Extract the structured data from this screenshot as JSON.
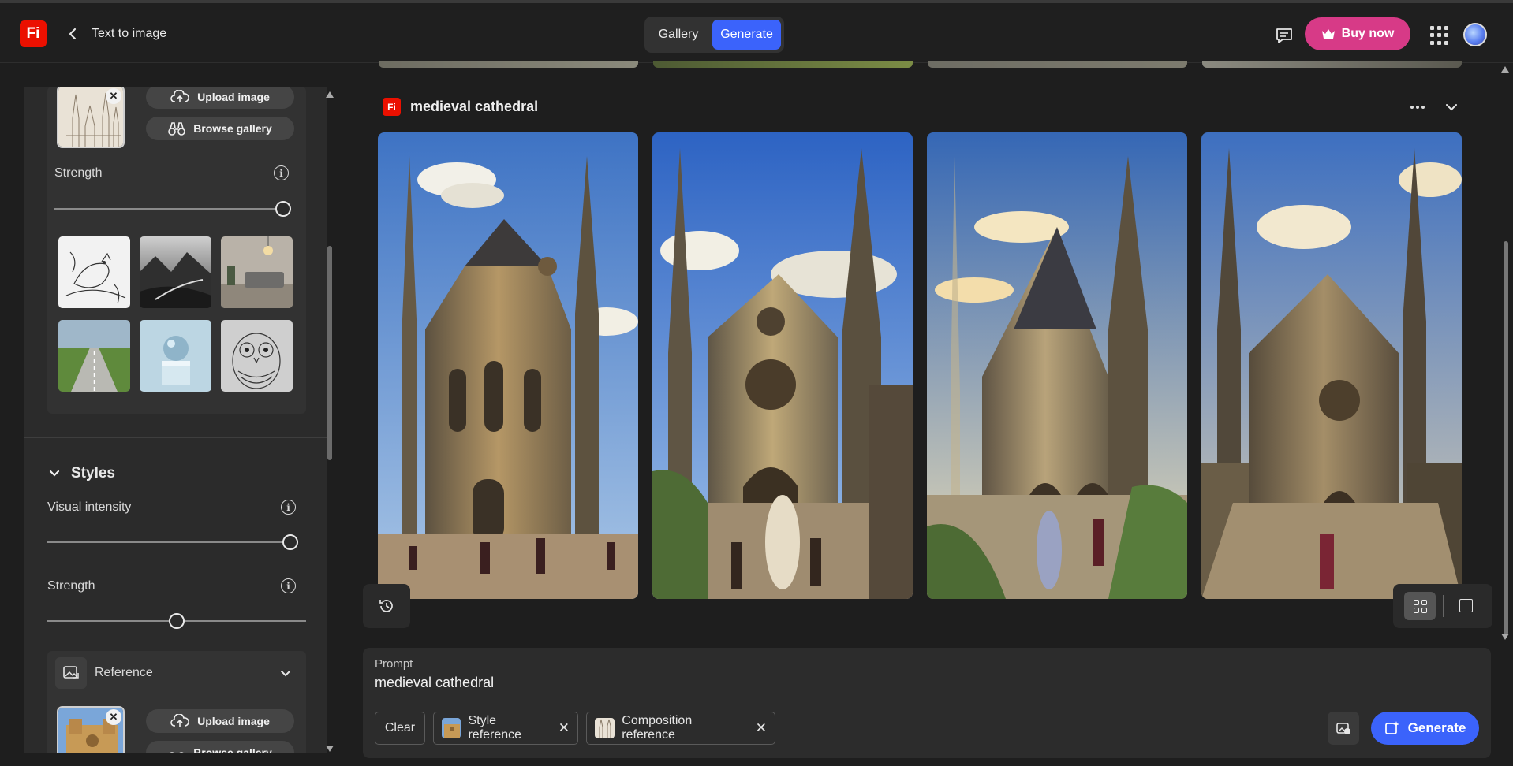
{
  "header": {
    "logo_text": "Fi",
    "title": "Text to image",
    "tabs": [
      {
        "label": "Gallery"
      },
      {
        "label": "Generate"
      }
    ],
    "active_tab": "Generate",
    "buy_label": "Buy now"
  },
  "left_panel": {
    "composition": {
      "upload_label": "Upload image",
      "browse_label": "Browse gallery",
      "strength_label": "Strength",
      "strength_value": 1.0,
      "presets": [
        "bird-sketch",
        "misty-mountains",
        "living-room",
        "green-road",
        "sphere-on-cube",
        "owl-pattern"
      ]
    },
    "styles": {
      "title": "Styles",
      "visual_intensity_label": "Visual intensity",
      "visual_intensity_value": 1.0,
      "strength_label": "Strength",
      "strength_value": 0.5,
      "reference_label": "Reference",
      "upload_label": "Upload image",
      "browse_label": "Browse gallery"
    }
  },
  "generation": {
    "logo_text": "Fi",
    "title": "medieval cathedral",
    "images": [
      {
        "name": "cathedral-1"
      },
      {
        "name": "cathedral-2"
      },
      {
        "name": "cathedral-3"
      },
      {
        "name": "cathedral-4"
      }
    ]
  },
  "prompt": {
    "label": "Prompt",
    "text": "medieval cathedral",
    "clear_label": "Clear",
    "chips": [
      {
        "label": "Style reference"
      },
      {
        "label": "Composition reference"
      }
    ],
    "generate_label": "Generate"
  },
  "colors": {
    "accent": "#3b63fb",
    "brand": "#eb1000",
    "buy": "#d73a87",
    "background": "#1e1e1e"
  }
}
